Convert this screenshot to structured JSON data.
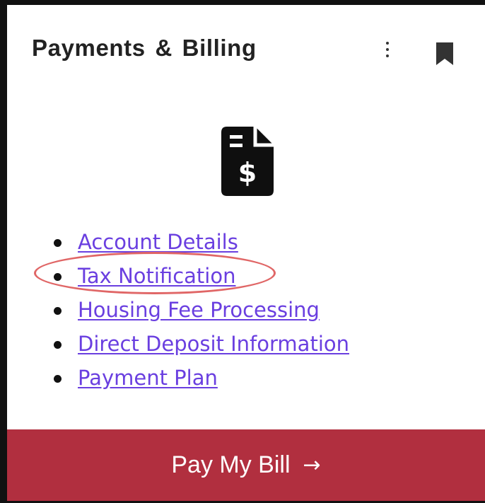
{
  "card": {
    "title": "Payments & Billing",
    "menu_icon": "kebab-menu-icon",
    "bookmark_icon": "bookmark-icon",
    "illustration_icon": "invoice-dollar-icon"
  },
  "links": [
    {
      "label": "Account Details"
    },
    {
      "label": "Tax Notification"
    },
    {
      "label": "Housing Fee Processing"
    },
    {
      "label": "Direct Deposit Information"
    },
    {
      "label": "Payment Plan"
    }
  ],
  "pay_button": {
    "label": "Pay My Bill",
    "arrow": "→"
  },
  "colors": {
    "link": "#6a3fe0",
    "button_bg": "#b12f3f",
    "annotation": "#e06666"
  }
}
